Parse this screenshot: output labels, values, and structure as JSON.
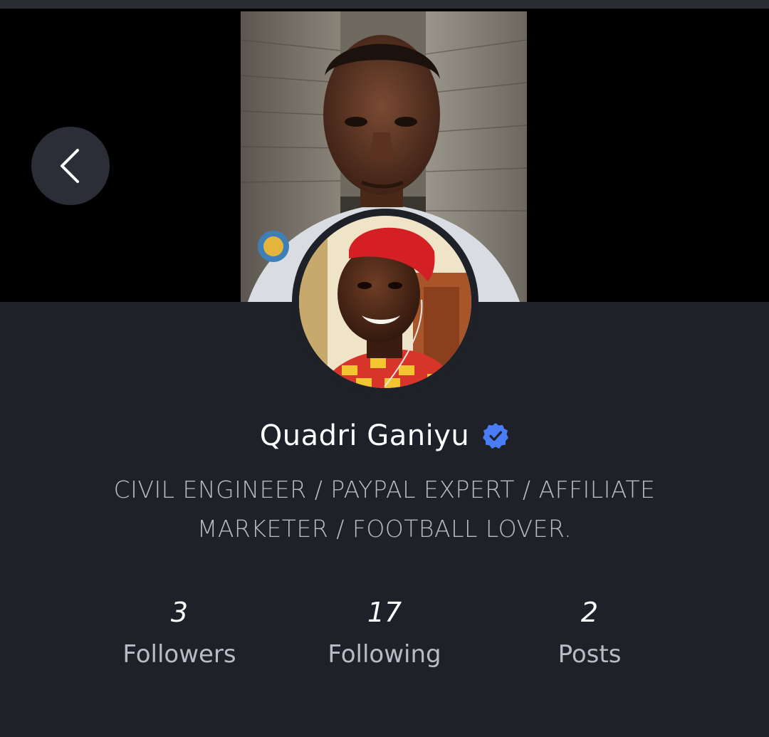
{
  "profile": {
    "name": "Quadri Ganiyu",
    "verified": true,
    "bio": "CIVIL ENGINEER / PAYPAL EXPERT / AFFILIATE MARKETER / FOOTBALL LOVER."
  },
  "stats": {
    "followers": {
      "count": "3",
      "label": "Followers"
    },
    "following": {
      "count": "17",
      "label": "Following"
    },
    "posts": {
      "count": "2",
      "label": "Posts"
    }
  },
  "icons": {
    "back": "chevron-left-icon",
    "verified": "verified-badge-icon"
  },
  "colors": {
    "background": "#1f2128",
    "cover_background": "#000000",
    "verified_badge": "#4a7cf6",
    "text_primary": "#ffffff",
    "text_secondary": "#b9bcc4"
  }
}
